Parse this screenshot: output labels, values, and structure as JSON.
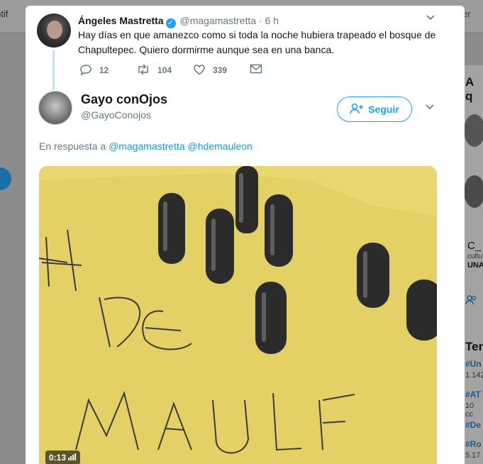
{
  "background": {
    "left_text": "otif",
    "right_text": "er",
    "right_heading": "A q",
    "right_c": "C_",
    "right_cult": "cultu",
    "right_una": "UNA",
    "trends_heading": "Ten",
    "trends": [
      {
        "tag": "#Un",
        "sub": "1.142"
      },
      {
        "tag": "#AT",
        "sub": "10 cc"
      },
      {
        "tag": "#De",
        "sub": ""
      },
      {
        "tag": "#Ro",
        "sub": "5.17"
      }
    ]
  },
  "parent_tweet": {
    "name": "Ángeles Mastretta",
    "handle": "@magamastretta",
    "separator": "·",
    "time": "6 h",
    "text": "Hay días en que amanezco como si toda la noche hubiera trapeado el bosque de Chapultepec. Quiero dormirme aunque sea en una banca.",
    "replies": "12",
    "retweets": "104",
    "likes": "339"
  },
  "main_tweet": {
    "name": "Gayo conOjos",
    "handle": "@GayoConojos",
    "follow_label": "Seguir",
    "reply_prefix": "En respuesta a",
    "reply_user1": "@magamastretta",
    "reply_user2": "@hdemauleon",
    "video_duration": "0:13"
  },
  "colors": {
    "accent": "#1da1f2",
    "link": "#1b95e0",
    "muted": "#657786"
  }
}
